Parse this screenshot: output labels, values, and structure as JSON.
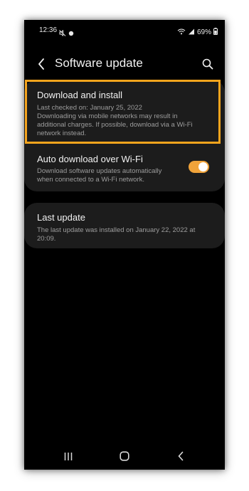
{
  "status_bar": {
    "time": "12:36",
    "battery_percent": "69%",
    "left_icons": [
      "mute-icon",
      "notification-dot-icon"
    ],
    "right_icons": [
      "wifi-icon",
      "signal-icon",
      "battery-icon"
    ]
  },
  "app_bar": {
    "title": "Software update",
    "back_icon": "back-chevron-icon",
    "search_icon": "search-icon"
  },
  "items": {
    "download": {
      "title": "Download and install",
      "subtitle_line1": "Last checked on: January 25, 2022",
      "subtitle_line2": "Downloading via mobile networks may result in",
      "subtitle_line3": "additional charges. If possible, download via a Wi-Fi",
      "subtitle_line4": "network instead."
    },
    "auto_download": {
      "title": "Auto download over Wi-Fi",
      "subtitle_line1": "Download software updates automatically",
      "subtitle_line2": "when connected to a Wi-Fi network.",
      "toggle_on": true
    },
    "last_update": {
      "title": "Last update",
      "subtitle_line1": "The last update was installed on January 22, 2022 at",
      "subtitle_line2": "20:09."
    }
  },
  "nav_bar": {
    "icons": [
      "recent-apps-icon",
      "home-icon",
      "back-nav-icon"
    ]
  },
  "colors": {
    "highlight": "#f5a41d",
    "toggle_on": "#f0a33a",
    "card_bg": "#1c1c1c",
    "screen_bg": "#000000"
  }
}
